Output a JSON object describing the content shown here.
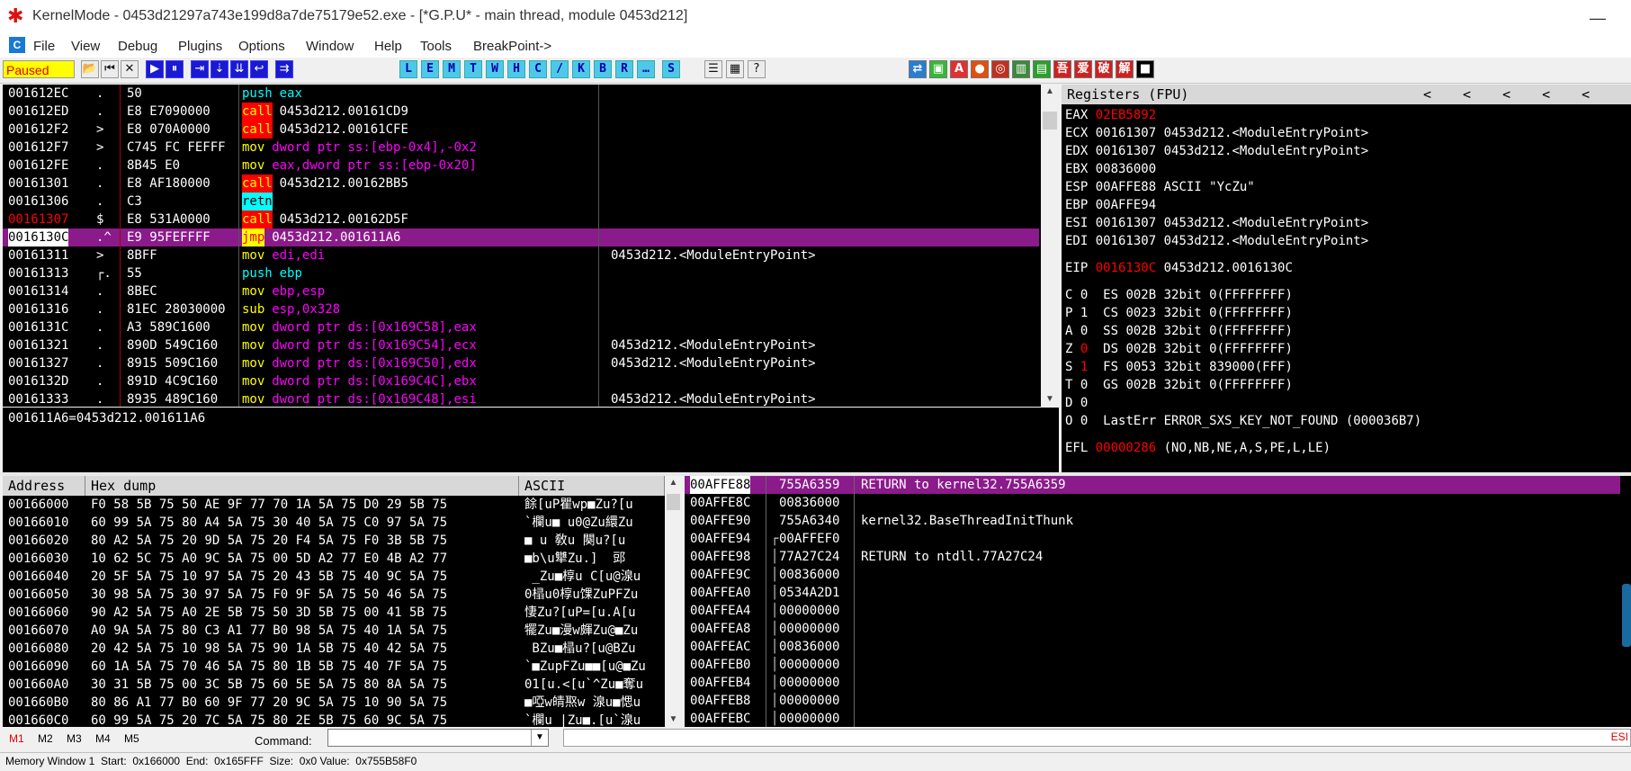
{
  "window": {
    "title": "KernelMode - 0453d21297a743e199d8a7de75179e52.exe - [*G.P.U* - main thread, module 0453d212]",
    "minimize_glyph": "—",
    "app_icon": "ladybug-icon",
    "mdi_icon_label": "C"
  },
  "menu": [
    "File",
    "View",
    "Debug",
    "Plugins",
    "Options",
    "Window",
    "Help",
    "Tools",
    "BreakPoint->"
  ],
  "toolbar": {
    "status": "Paused",
    "status_colors": {
      "bg": "#ffff00",
      "fg": "#e00000"
    },
    "nav_glyphs": [
      "📂",
      "⏮",
      "✕",
      "▶",
      "⏸",
      "⇥",
      "⇣",
      "⇊",
      "↩",
      "⇉"
    ],
    "letter_buttons": [
      "L",
      "E",
      "M",
      "T",
      "W",
      "H",
      "C",
      "/",
      "K",
      "B",
      "R",
      "…",
      "S"
    ],
    "right_glyphs": [
      "☰",
      "▦",
      "?"
    ],
    "plugin_glyphs": [
      "⇄",
      "▣",
      "A",
      "●",
      "◎",
      "▥",
      "▤",
      "吾",
      "爱",
      "破",
      "解",
      "■"
    ],
    "plugin_colors": [
      "#2a7dd0",
      "#38b838",
      "#e03030",
      "#e05010",
      "#c03020",
      "#3a8a3a",
      "#2aa02a",
      "#d02020",
      "#d02020",
      "#d02020",
      "#d02020",
      "#000000"
    ]
  },
  "disasm": {
    "rows": [
      {
        "addr": "001612EC",
        "mark": ".",
        "hex": "50",
        "op": "push",
        "arg": "eax",
        "cmt": "",
        "type": "push"
      },
      {
        "addr": "001612ED",
        "mark": ".",
        "hex": "E8 E7090000",
        "op": "call",
        "arg": "0453d212.00161CD9",
        "cmt": "",
        "type": "call"
      },
      {
        "addr": "001612F2",
        "mark": ">",
        "hex": "E8 070A0000",
        "op": "call",
        "arg": "0453d212.00161CFE",
        "cmt": "",
        "type": "call"
      },
      {
        "addr": "001612F7",
        "mark": ">",
        "hex": "C745 FC FEFFF",
        "op": "mov",
        "arg": "dword ptr ss:[ebp-0x4],-0x2",
        "cmt": "",
        "type": "mov"
      },
      {
        "addr": "001612FE",
        "mark": ".",
        "hex": "8B45 E0",
        "op": "mov",
        "arg": "eax,dword ptr ss:[ebp-0x20]",
        "cmt": "",
        "type": "mov"
      },
      {
        "addr": "00161301",
        "mark": ".",
        "hex": "E8 AF180000",
        "op": "call",
        "arg": "0453d212.00162BB5",
        "cmt": "",
        "type": "call"
      },
      {
        "addr": "00161306",
        "mark": ".",
        "hex": "C3",
        "op": "retn",
        "arg": "",
        "cmt": "",
        "type": "retn"
      },
      {
        "addr": "00161307",
        "mark": "$",
        "hex": "E8 531A0000",
        "op": "call",
        "arg": "0453d212.00162D5F",
        "cmt": "",
        "type": "call",
        "addr_red": true
      },
      {
        "addr": "0016130C",
        "mark": ".^",
        "hex": "E9 95FEFFFF",
        "op": "jmp",
        "arg": "0453d212.001611A6",
        "cmt": "",
        "type": "jmp",
        "selected": true
      },
      {
        "addr": "00161311",
        "mark": ">",
        "hex": "8BFF",
        "op": "mov",
        "arg": "edi,edi",
        "cmt": "0453d212.<ModuleEntryPoint>",
        "type": "mov"
      },
      {
        "addr": "00161313",
        "mark": "┌.",
        "hex": "55",
        "op": "push",
        "arg": "ebp",
        "cmt": "",
        "type": "push"
      },
      {
        "addr": "00161314",
        "mark": ".",
        "hex": "8BEC",
        "op": "mov",
        "arg": "ebp,esp",
        "cmt": "",
        "type": "mov"
      },
      {
        "addr": "00161316",
        "mark": ".",
        "hex": "81EC 28030000",
        "op": "sub",
        "arg": "esp,0x328",
        "cmt": "",
        "type": "sub"
      },
      {
        "addr": "0016131C",
        "mark": ".",
        "hex": "A3 589C1600",
        "op": "mov",
        "arg": "dword ptr ds:[0x169C58],eax",
        "cmt": "",
        "type": "mov"
      },
      {
        "addr": "00161321",
        "mark": ".",
        "hex": "890D 549C160",
        "op": "mov",
        "arg": "dword ptr ds:[0x169C54],ecx",
        "cmt": "0453d212.<ModuleEntryPoint>",
        "type": "mov"
      },
      {
        "addr": "00161327",
        "mark": ".",
        "hex": "8915 509C160",
        "op": "mov",
        "arg": "dword ptr ds:[0x169C50],edx",
        "cmt": "0453d212.<ModuleEntryPoint>",
        "type": "mov"
      },
      {
        "addr": "0016132D",
        "mark": ".",
        "hex": "891D 4C9C160",
        "op": "mov",
        "arg": "dword ptr ds:[0x169C4C],ebx",
        "cmt": "",
        "type": "mov"
      },
      {
        "addr": "00161333",
        "mark": ".",
        "hex": "8935 489C160",
        "op": "mov",
        "arg": "dword ptr ds:[0x169C48],esi",
        "cmt": "0453d212.<ModuleEntryPoint>",
        "type": "mov"
      }
    ],
    "info_line": "001611A6=0453d212.001611A6"
  },
  "registers": {
    "header": "Registers (FPU)",
    "header_arrows": [
      "<",
      "<",
      "<",
      "<",
      "<"
    ],
    "rows": [
      {
        "t": "EAX ",
        "v": "02EB5892",
        "c": "",
        "red": true
      },
      {
        "t": "ECX ",
        "v": "00161307",
        "c": " 0453d212.<ModuleEntryPoint>"
      },
      {
        "t": "EDX ",
        "v": "00161307",
        "c": " 0453d212.<ModuleEntryPoint>"
      },
      {
        "t": "EBX ",
        "v": "00836000",
        "c": ""
      },
      {
        "t": "ESP ",
        "v": "00AFFE88",
        "c": " ASCII \"YcZu\""
      },
      {
        "t": "EBP ",
        "v": "00AFFE94",
        "c": ""
      },
      {
        "t": "ESI ",
        "v": "00161307",
        "c": " 0453d212.<ModuleEntryPoint>"
      },
      {
        "t": "EDI ",
        "v": "00161307",
        "c": " 0453d212.<ModuleEntryPoint>"
      },
      {
        "t": "",
        "v": "",
        "c": ""
      },
      {
        "t": "EIP ",
        "v": "0016130C",
        "c": " 0453d212.0016130C",
        "red": true
      },
      {
        "t": "",
        "v": "",
        "c": "",
        "half": true
      },
      {
        "t": "C 0  ",
        "v": "",
        "c": "ES 002B 32bit 0(FFFFFFFF)"
      },
      {
        "t": "P 1  ",
        "v": "",
        "c": "CS 0023 32bit 0(FFFFFFFF)"
      },
      {
        "t": "A 0  ",
        "v": "",
        "c": "SS 002B 32bit 0(FFFFFFFF)"
      },
      {
        "t": "Z ",
        "v": "0",
        "c": "  DS 002B 32bit 0(FFFFFFFF)",
        "red": true
      },
      {
        "t": "S ",
        "v": "1",
        "c": "  FS 0053 32bit 839000(FFF)",
        "red": true
      },
      {
        "t": "T 0  ",
        "v": "",
        "c": "GS 002B 32bit 0(FFFFFFFF)"
      },
      {
        "t": "D 0",
        "v": "",
        "c": ""
      },
      {
        "t": "O 0  ",
        "v": "",
        "c": "LastErr ERROR_SXS_KEY_NOT_FOUND (000036B7)"
      },
      {
        "t": "",
        "v": "",
        "c": "",
        "half": true
      },
      {
        "t": "EFL ",
        "v": "00000286",
        "c": " (NO,NB,NE,A,S,PE,L,LE)",
        "red": true
      }
    ]
  },
  "dump": {
    "headers": {
      "address": "Address",
      "hex": "Hex dump",
      "ascii": "ASCII"
    },
    "rows": [
      {
        "a": "00166000",
        "h": "F0 58 5B 75 50 AE 9F 77 70 1A 5A 75 D0 29 5B 75",
        "s": "餘[uP瞿wp■Zu?[u"
      },
      {
        "a": "00166010",
        "h": "60 99 5A 75 80 A4 5A 75 30 40 5A 75 C0 97 5A 75",
        "s": "`欄u■ u0@Zu繯Zu"
      },
      {
        "a": "00166020",
        "h": "80 A2 5A 75 20 9D 5A 75 20 F4 5A 75 F0 3B 5B 75",
        "s": "■ u 敎u 闋u?[u"
      },
      {
        "a": "00166030",
        "h": "10 62 5C 75 A0 9C 5A 75 00 5D A2 77 E0 4B A2 77",
        "s": "■b\\u犫Zu.]  郖"
      },
      {
        "a": "00166040",
        "h": "20 5F 5A 75 10 97 5A 75 20 43 5B 75 40 9C 5A 75",
        "s": " _Zu■椁u C[u@湶u"
      },
      {
        "a": "00166050",
        "h": "30 98 5A 75 30 97 5A 75 F0 9F 5A 75 50 46 5A 75",
        "s": "0榋u0椁u馃ZuPFZu"
      },
      {
        "a": "00166060",
        "h": "90 A2 5A 75 A0 2E 5B 75 50 3D 5B 75 00 41 5B 75",
        "s": "悽Zu?[uP=[u.A[u"
      },
      {
        "a": "00166070",
        "h": "A0 9A 5A 75 80 C3 A1 77 B0 98 5A 75 40 1A 5A 75",
        "s": "犤Zu■漫w皹Zu@■Zu"
      },
      {
        "a": "00166080",
        "h": "20 42 5A 75 10 98 5A 75 90 1A 5B 75 40 42 5A 75",
        "s": " BZu■榋u?[u@BZu"
      },
      {
        "a": "00166090",
        "h": "60 1A 5A 75 70 46 5A 75 80 1B 5B 75 40 7F 5A 75",
        "s": "`■ZupFZu■■[u@■Zu"
      },
      {
        "a": "001660A0",
        "h": "30 31 5B 75 00 3C 5B 75 60 5E 5A 75 80 8A 5A 75",
        "s": "01[u.<[u`^Zu■奪u"
      },
      {
        "a": "001660B0",
        "h": "80 86 A1 77 B0 60 9F 77 20 9C 5A 75 10 90 5A 75",
        "s": "■啞w皘焣w 湶u■愢u"
      },
      {
        "a": "001660C0",
        "h": "60 99 5A 75 20 7C 5A 75 80 2E 5B 75 60 9C 5A 75",
        "s": "`欄u |Zu■.[u`湶u"
      }
    ]
  },
  "stack": {
    "rows": [
      {
        "a": "00AFFE88",
        "v": "755A6359",
        "c": "RETURN to kernel32.755A6359",
        "selected": true
      },
      {
        "a": "00AFFE8C",
        "v": "00836000",
        "c": ""
      },
      {
        "a": "00AFFE90",
        "v": "755A6340",
        "c": "kernel32.BaseThreadInitThunk"
      },
      {
        "a": "00AFFE94",
        "v": "00AFFEF0",
        "c": "",
        "bracket": "┌"
      },
      {
        "a": "00AFFE98",
        "v": "77A27C24",
        "c": "RETURN to ntdll.77A27C24",
        "bracket": "│"
      },
      {
        "a": "00AFFE9C",
        "v": "00836000",
        "c": "",
        "bracket": "│"
      },
      {
        "a": "00AFFEA0",
        "v": "0534A2D1",
        "c": "",
        "bracket": "│"
      },
      {
        "a": "00AFFEA4",
        "v": "00000000",
        "c": "",
        "bracket": "│"
      },
      {
        "a": "00AFFEA8",
        "v": "00000000",
        "c": "",
        "bracket": "│"
      },
      {
        "a": "00AFFEAC",
        "v": "00836000",
        "c": "",
        "bracket": "│"
      },
      {
        "a": "00AFFEB0",
        "v": "00000000",
        "c": "",
        "bracket": "│"
      },
      {
        "a": "00AFFEB4",
        "v": "00000000",
        "c": "",
        "bracket": "│"
      },
      {
        "a": "00AFFEB8",
        "v": "00000000",
        "c": "",
        "bracket": "│"
      },
      {
        "a": "00AFFEBC",
        "v": "00000000",
        "c": "",
        "bracket": "│"
      }
    ]
  },
  "command": {
    "tabs": [
      "M1",
      "M2",
      "M3",
      "M4",
      "M5"
    ],
    "label": "Command:",
    "value": "",
    "right_label": "ESI"
  },
  "status": {
    "text": "Memory Window 1  Start:  0x166000  End:  0x165FFF  Size:  0x0 Value:  0x755B58F0"
  },
  "colors": {
    "call_bg": "#ff0000",
    "call_fg": "#ffff00",
    "mov_fg": "#ffff00",
    "arg_mov": "#ff00ff",
    "push_fg": "#00ffff",
    "retn_bg": "#00ffff",
    "jmp_bg": "#ffff00",
    "jmp_fg": "#ff0000",
    "sel_bg": "#8b1a8b",
    "num": "#ff8000",
    "reg_fg": "#ffffff",
    "red": "#ff0000"
  }
}
